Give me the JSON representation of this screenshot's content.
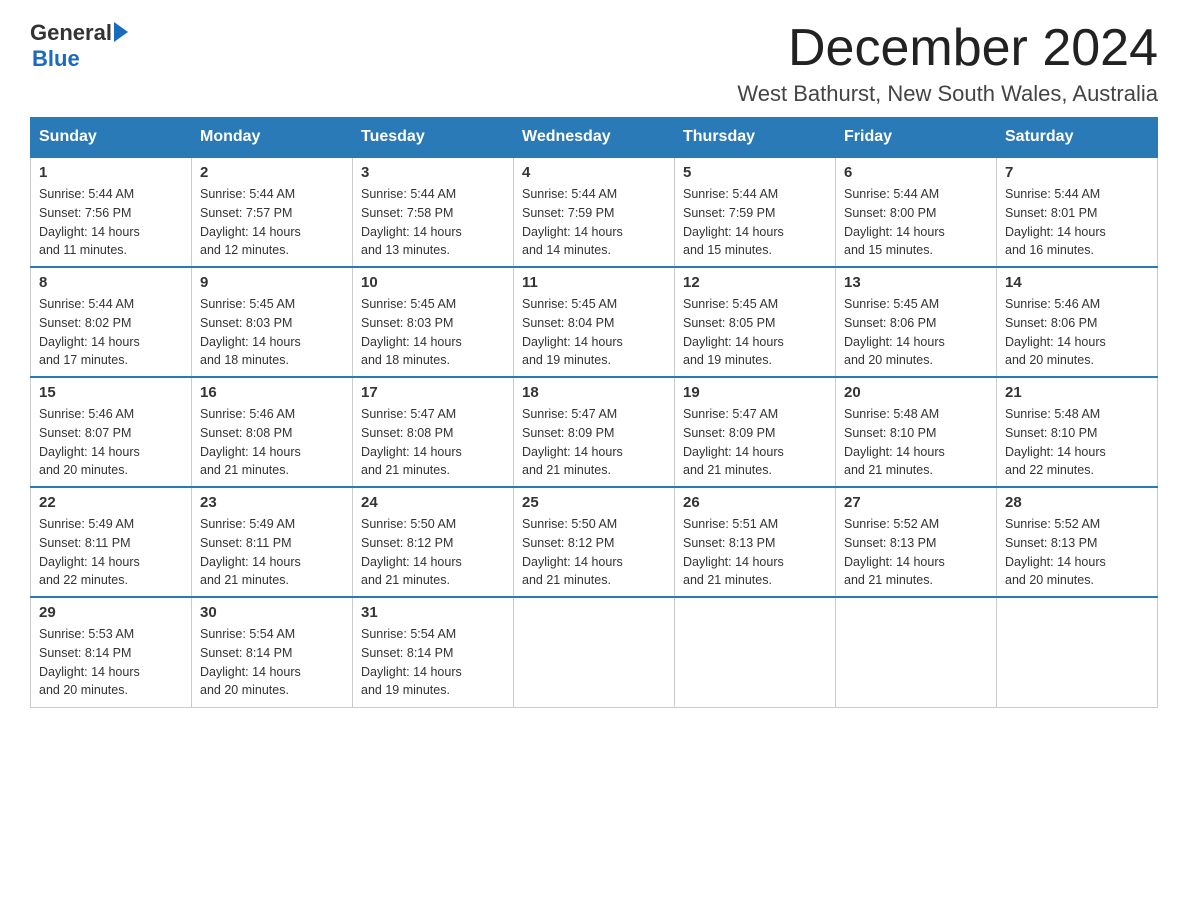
{
  "header": {
    "logo_general": "General",
    "logo_blue": "Blue",
    "month_title": "December 2024",
    "location": "West Bathurst, New South Wales, Australia"
  },
  "days_of_week": [
    "Sunday",
    "Monday",
    "Tuesday",
    "Wednesday",
    "Thursday",
    "Friday",
    "Saturday"
  ],
  "weeks": [
    [
      {
        "day": "1",
        "sunrise": "5:44 AM",
        "sunset": "7:56 PM",
        "daylight": "14 hours and 11 minutes."
      },
      {
        "day": "2",
        "sunrise": "5:44 AM",
        "sunset": "7:57 PM",
        "daylight": "14 hours and 12 minutes."
      },
      {
        "day": "3",
        "sunrise": "5:44 AM",
        "sunset": "7:58 PM",
        "daylight": "14 hours and 13 minutes."
      },
      {
        "day": "4",
        "sunrise": "5:44 AM",
        "sunset": "7:59 PM",
        "daylight": "14 hours and 14 minutes."
      },
      {
        "day": "5",
        "sunrise": "5:44 AM",
        "sunset": "7:59 PM",
        "daylight": "14 hours and 15 minutes."
      },
      {
        "day": "6",
        "sunrise": "5:44 AM",
        "sunset": "8:00 PM",
        "daylight": "14 hours and 15 minutes."
      },
      {
        "day": "7",
        "sunrise": "5:44 AM",
        "sunset": "8:01 PM",
        "daylight": "14 hours and 16 minutes."
      }
    ],
    [
      {
        "day": "8",
        "sunrise": "5:44 AM",
        "sunset": "8:02 PM",
        "daylight": "14 hours and 17 minutes."
      },
      {
        "day": "9",
        "sunrise": "5:45 AM",
        "sunset": "8:03 PM",
        "daylight": "14 hours and 18 minutes."
      },
      {
        "day": "10",
        "sunrise": "5:45 AM",
        "sunset": "8:03 PM",
        "daylight": "14 hours and 18 minutes."
      },
      {
        "day": "11",
        "sunrise": "5:45 AM",
        "sunset": "8:04 PM",
        "daylight": "14 hours and 19 minutes."
      },
      {
        "day": "12",
        "sunrise": "5:45 AM",
        "sunset": "8:05 PM",
        "daylight": "14 hours and 19 minutes."
      },
      {
        "day": "13",
        "sunrise": "5:45 AM",
        "sunset": "8:06 PM",
        "daylight": "14 hours and 20 minutes."
      },
      {
        "day": "14",
        "sunrise": "5:46 AM",
        "sunset": "8:06 PM",
        "daylight": "14 hours and 20 minutes."
      }
    ],
    [
      {
        "day": "15",
        "sunrise": "5:46 AM",
        "sunset": "8:07 PM",
        "daylight": "14 hours and 20 minutes."
      },
      {
        "day": "16",
        "sunrise": "5:46 AM",
        "sunset": "8:08 PM",
        "daylight": "14 hours and 21 minutes."
      },
      {
        "day": "17",
        "sunrise": "5:47 AM",
        "sunset": "8:08 PM",
        "daylight": "14 hours and 21 minutes."
      },
      {
        "day": "18",
        "sunrise": "5:47 AM",
        "sunset": "8:09 PM",
        "daylight": "14 hours and 21 minutes."
      },
      {
        "day": "19",
        "sunrise": "5:47 AM",
        "sunset": "8:09 PM",
        "daylight": "14 hours and 21 minutes."
      },
      {
        "day": "20",
        "sunrise": "5:48 AM",
        "sunset": "8:10 PM",
        "daylight": "14 hours and 21 minutes."
      },
      {
        "day": "21",
        "sunrise": "5:48 AM",
        "sunset": "8:10 PM",
        "daylight": "14 hours and 22 minutes."
      }
    ],
    [
      {
        "day": "22",
        "sunrise": "5:49 AM",
        "sunset": "8:11 PM",
        "daylight": "14 hours and 22 minutes."
      },
      {
        "day": "23",
        "sunrise": "5:49 AM",
        "sunset": "8:11 PM",
        "daylight": "14 hours and 21 minutes."
      },
      {
        "day": "24",
        "sunrise": "5:50 AM",
        "sunset": "8:12 PM",
        "daylight": "14 hours and 21 minutes."
      },
      {
        "day": "25",
        "sunrise": "5:50 AM",
        "sunset": "8:12 PM",
        "daylight": "14 hours and 21 minutes."
      },
      {
        "day": "26",
        "sunrise": "5:51 AM",
        "sunset": "8:13 PM",
        "daylight": "14 hours and 21 minutes."
      },
      {
        "day": "27",
        "sunrise": "5:52 AM",
        "sunset": "8:13 PM",
        "daylight": "14 hours and 21 minutes."
      },
      {
        "day": "28",
        "sunrise": "5:52 AM",
        "sunset": "8:13 PM",
        "daylight": "14 hours and 20 minutes."
      }
    ],
    [
      {
        "day": "29",
        "sunrise": "5:53 AM",
        "sunset": "8:14 PM",
        "daylight": "14 hours and 20 minutes."
      },
      {
        "day": "30",
        "sunrise": "5:54 AM",
        "sunset": "8:14 PM",
        "daylight": "14 hours and 20 minutes."
      },
      {
        "day": "31",
        "sunrise": "5:54 AM",
        "sunset": "8:14 PM",
        "daylight": "14 hours and 19 minutes."
      },
      null,
      null,
      null,
      null
    ]
  ],
  "labels": {
    "sunrise": "Sunrise:",
    "sunset": "Sunset:",
    "daylight": "Daylight:"
  }
}
